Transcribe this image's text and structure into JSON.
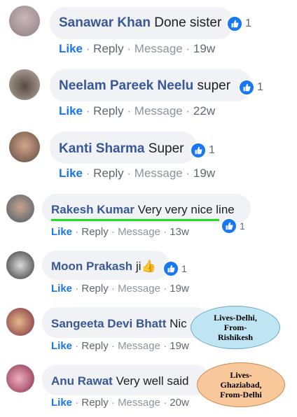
{
  "comments": [
    {
      "name": "Sanawar Khan",
      "text": "Done sister",
      "reactions": "1",
      "actions": {
        "like": "Like",
        "reply": "Reply",
        "message": "Message",
        "time": "19w"
      },
      "avatar_icon": "avatar-photo"
    },
    {
      "name": "Neelam Pareek Neelu",
      "text": "super",
      "reactions": "1",
      "actions": {
        "like": "Like",
        "reply": "Reply",
        "message": "Message",
        "time": "22w"
      },
      "avatar_icon": "avatar-photo"
    },
    {
      "name": "Kanti Sharma",
      "text": "Super",
      "reactions": "1",
      "actions": {
        "like": "Like",
        "reply": "Reply",
        "message": "Message",
        "time": "19w"
      },
      "avatar_icon": "avatar-photo"
    },
    {
      "name": "Rakesh Kumar",
      "text": "Very very nice line",
      "reactions": "1",
      "actions": {
        "like": "Like",
        "reply": "Reply",
        "message": "Message",
        "time": "13w"
      },
      "avatar_icon": "avatar-photo"
    },
    {
      "name": "Moon Prakash",
      "text": "ji",
      "emoji": "👍",
      "reactions": "1",
      "actions": {
        "like": "Like",
        "reply": "Reply",
        "message": "Message",
        "time": "19w"
      },
      "avatar_icon": "avatar-photo"
    },
    {
      "name": "Sangeeta Devi Bhatt",
      "text": "Nic",
      "actions": {
        "like": "Like",
        "reply": "Reply",
        "message": "Message",
        "time": "19w"
      },
      "avatar_icon": "avatar-photo"
    },
    {
      "name": "Anu Rawat",
      "text": "Very well said",
      "actions": {
        "like": "Like",
        "reply": "Reply",
        "message": "Message",
        "time": "20w"
      },
      "avatar_icon": "avatar-photo"
    }
  ],
  "separator": "·",
  "annotations": [
    {
      "text": "Lives-Delhi,\nFrom-\nRishikesh",
      "color": "#bfe4f2"
    },
    {
      "text": "Lives-\nGhaziabad,\nFrom-Delhi",
      "color": "#f8c79a"
    }
  ],
  "colors": {
    "name": "#385898",
    "like": "#1877f2",
    "meta": "#8d949e",
    "bubble": "#f0f2f5",
    "highlight_line": "#22dd22"
  }
}
